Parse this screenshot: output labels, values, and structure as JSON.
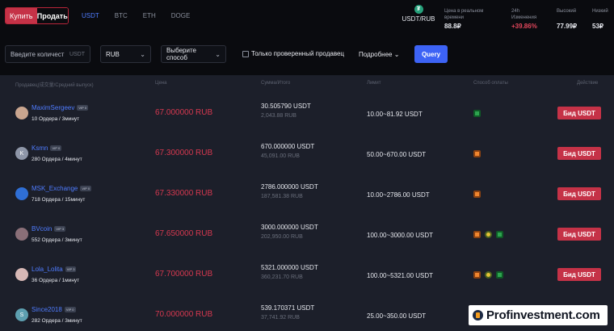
{
  "topbar": {
    "buy_label": "Купить",
    "sell_label": "Продать",
    "coins": [
      "USDT",
      "BTC",
      "ETH",
      "DOGE"
    ],
    "active_coin": "USDT",
    "pair": {
      "icon": "tether-icon",
      "label": "USDT/RUB"
    },
    "stats": [
      {
        "label1": "Цена в реальном",
        "label2": "времени",
        "value": "88.8₽"
      },
      {
        "label1": "24h",
        "label2": "Изменения",
        "value": "+39.86%"
      },
      {
        "label1": "Высокий",
        "label2": "",
        "value": "77.99₽"
      },
      {
        "label1": "Низкий",
        "label2": "",
        "value": "53₽"
      }
    ]
  },
  "filters": {
    "amount_placeholder": "Введите количест",
    "amount_suffix": "USDT",
    "currency": "RUB",
    "payment_placeholder": "Выберите способ",
    "verified_label": "Только проверенный продавец",
    "more_label": "Подробнее",
    "query_label": "Query"
  },
  "table": {
    "headers": {
      "seller": "Продавец(成交量/Средний выпуск)",
      "price": "Цена",
      "amount": "Сумма/Итого",
      "limit": "Лимит",
      "payment": "Способ оплаты",
      "action": "Действие"
    },
    "rows": [
      {
        "name": "MaximSergeev",
        "vip": "VIP 0",
        "orders": "10 Ордера / 3минут",
        "price": "67.000000 RUB",
        "amount": "30.505790 USDT",
        "total": "2,043.88 RUB",
        "limit": "10.00~81.92 USDT",
        "payments": [
          "green"
        ],
        "bid": "Бид USDT",
        "avatar_color": "#c9a58f",
        "avatar_letter": ""
      },
      {
        "name": "Ksmn",
        "vip": "VIP 0",
        "orders": "280 Ордера / 4минут",
        "price": "67.300000 RUB",
        "amount": "670.000000 USDT",
        "total": "45,091.00 RUB",
        "limit": "50.00~670.00 USDT",
        "payments": [
          "orange"
        ],
        "bid": "Бид USDT",
        "avatar_color": "#8e96a8",
        "avatar_letter": "K"
      },
      {
        "name": "MSK_Exchange",
        "vip": "VIP 0",
        "orders": "718 Ордера / 15минут",
        "price": "67.330000 RUB",
        "amount": "2786.000000 USDT",
        "total": "187,581.38 RUB",
        "limit": "10.00~2786.00 USDT",
        "payments": [
          "orange"
        ],
        "bid": "Бид USDT",
        "avatar_color": "#2f6fd6",
        "avatar_letter": ""
      },
      {
        "name": "BVcoin",
        "vip": "VIP 3",
        "orders": "552 Ордера / 3минут",
        "price": "67.650000 RUB",
        "amount": "3000.000000 USDT",
        "total": "202,950.00 RUB",
        "limit": "100.00~3000.00 USDT",
        "payments": [
          "orange",
          "yellow",
          "green"
        ],
        "bid": "Бид USDT",
        "avatar_color": "#8a6f78",
        "avatar_letter": ""
      },
      {
        "name": "Lola_Lolita",
        "vip": "VIP 3",
        "orders": "36 Ордера / 1минут",
        "price": "67.700000 RUB",
        "amount": "5321.000000 USDT",
        "total": "360,231.70 RUB",
        "limit": "100.00~5321.00 USDT",
        "payments": [
          "orange",
          "yellow",
          "green"
        ],
        "bid": "Бид USDT",
        "avatar_color": "#d7b8b6",
        "avatar_letter": ""
      },
      {
        "name": "Since2018",
        "vip": "VIP 0",
        "orders": "282 Ордера / 3минут",
        "price": "70.000000 RUB",
        "amount": "539.170371 USDT",
        "total": "37,741.92 RUB",
        "limit": "25.00~350.00 USDT",
        "payments": [],
        "bid": "",
        "avatar_color": "#5d9fb0",
        "avatar_letter": "S"
      }
    ]
  },
  "watermark": "Profinvestment.com"
}
